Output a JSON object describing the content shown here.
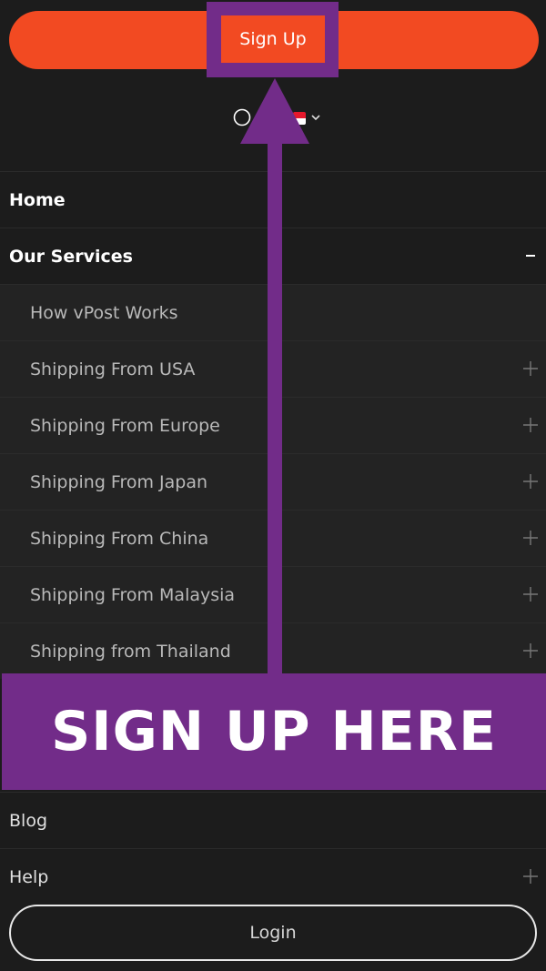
{
  "header": {
    "signup_label": "Sign Up",
    "accent_color": "#f24a22",
    "highlight_color": "#722c89"
  },
  "utility": {
    "search_icon": "search-icon",
    "flag_icon": "indonesia-flag-icon",
    "chevron_icon": "chevron-down-icon"
  },
  "menu": {
    "home": "Home",
    "services": {
      "label": "Our Services",
      "toggle": "-"
    },
    "sub_items": [
      "How vPost Works",
      "Shipping From USA",
      "Shipping From Europe",
      "Shipping From Japan",
      "Shipping From China",
      "Shipping From Malaysia",
      "Shipping from Thailand"
    ],
    "blog": "Blog",
    "help": "Help"
  },
  "annotation": {
    "banner_text": "SIGN UP HERE"
  },
  "footer": {
    "login_label": "Login"
  }
}
